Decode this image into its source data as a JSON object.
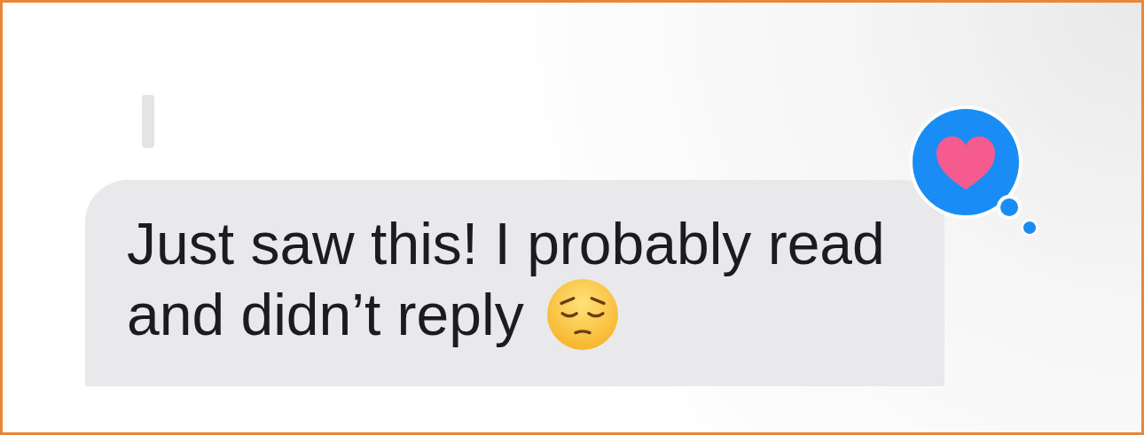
{
  "message": {
    "lines": [
      "Just saw this! I probably read",
      "and didn’t reply"
    ],
    "emoji": {
      "kind": "pensive"
    },
    "tapback": {
      "kind": "heart"
    }
  }
}
